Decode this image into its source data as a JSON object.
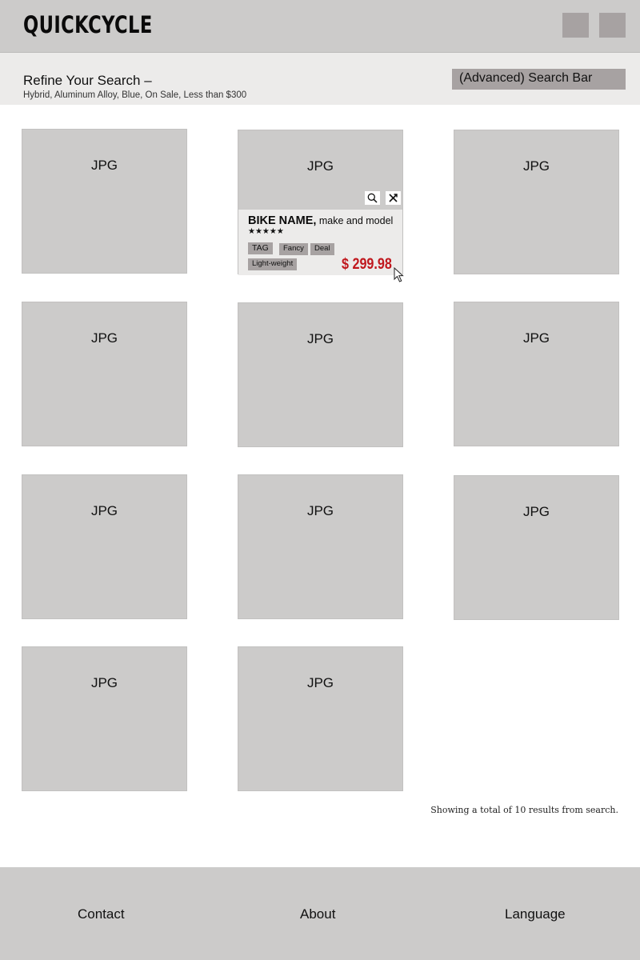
{
  "header": {
    "logo": "QUICKCYCLE",
    "buttons": [
      "header-button-1",
      "header-button-2"
    ]
  },
  "refine": {
    "title": "Refine Your Search –",
    "filters": "Hybrid, Aluminum Alloy, Blue, On Sale, Less than $300",
    "search_bar": "(Advanced) Search Bar"
  },
  "grid": {
    "placeholder": "JPG",
    "tiles": [
      "JPG",
      "JPG",
      "JPG",
      "JPG",
      "JPG",
      "JPG",
      "JPG",
      "JPG",
      "JPG",
      "JPG"
    ]
  },
  "hover_card": {
    "bike_name": "BIKE NAME,",
    "bike_model": " make and model",
    "stars": "★★★★★",
    "rating": 5,
    "tags": [
      "TAG",
      "Fancy",
      "Deal",
      "Light-weight"
    ],
    "price": "$ 299.98",
    "icons": [
      "search-icon",
      "shuffle-icon"
    ]
  },
  "results_text": "Showing a total of 10 results from search.",
  "footer": {
    "links": [
      "Contact",
      "About",
      "Language"
    ]
  },
  "colors": {
    "header_bg": "#cccbca",
    "refine_bg": "#ecebea",
    "button_bg": "#a7a2a2",
    "tile_bg": "#cccbca",
    "price": "#c0171d"
  }
}
